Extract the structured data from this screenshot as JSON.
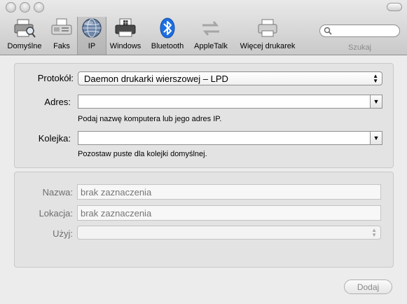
{
  "toolbar": {
    "tabs": [
      {
        "label": "Domyślne",
        "icon": "default-printer-icon"
      },
      {
        "label": "Faks",
        "icon": "fax-icon"
      },
      {
        "label": "IP",
        "icon": "ip-globe-icon",
        "selected": true
      },
      {
        "label": "Windows",
        "icon": "windows-printer-icon"
      },
      {
        "label": "Bluetooth",
        "icon": "bluetooth-icon"
      },
      {
        "label": "AppleTalk",
        "icon": "appletalk-icon"
      },
      {
        "label": "Więcej drukarek",
        "icon": "more-printers-icon"
      }
    ],
    "search": {
      "placeholder": "",
      "value": "",
      "label": "Szukaj"
    }
  },
  "ip_panel": {
    "protocol_label": "Protokół:",
    "protocol_value": "Daemon drukarki wierszowej – LPD",
    "address_label": "Adres:",
    "address_value": "",
    "address_hint": "Podaj nazwę komputera lub jego adres IP.",
    "queue_label": "Kolejka:",
    "queue_value": "",
    "queue_hint": "Pozostaw puste dla kolejki domyślnej."
  },
  "printer_info": {
    "name_label": "Nazwa:",
    "name_placeholder": "brak zaznaczenia",
    "location_label": "Lokacja:",
    "location_placeholder": "brak zaznaczenia",
    "use_label": "Użyj:",
    "use_value": ""
  },
  "footer": {
    "add_button": "Dodaj"
  },
  "colors": {
    "window_bg": "#ececec",
    "toolbar_top": "#e9e9e9",
    "toolbar_bottom": "#c9c9c9",
    "group_bg": "#e3e3e3",
    "bluetooth_blue": "#1d6fe0"
  }
}
